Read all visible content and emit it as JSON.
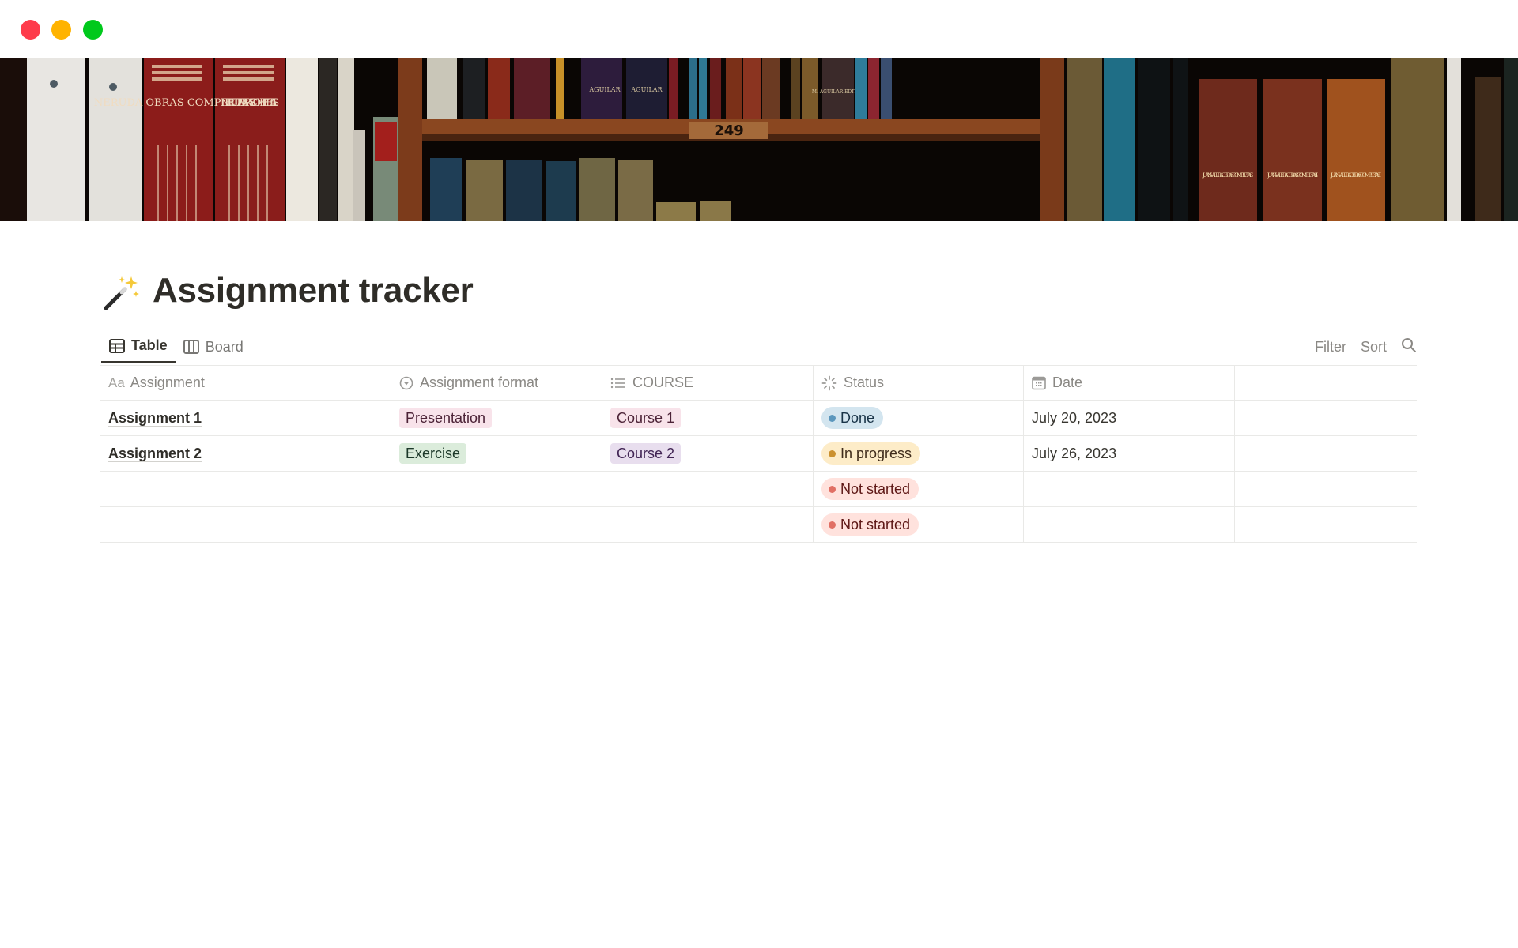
{
  "window": {
    "controls": [
      "close",
      "minimize",
      "zoom"
    ]
  },
  "banner": {
    "description": "Bookshelf photo cover",
    "shelf_label": "249",
    "spine_texts": [
      "NERUDA OBRAS COMPLETAS I",
      "NERUDA OBRAS COMPLETAS II",
      "AGUILAR",
      "AGUILAR",
      "M. AGUILAR EDITOR",
      "JUAN VALERA OBRAS COMPLETAS I",
      "JUAN VALERA OBRAS COMPLETAS II",
      "JUAN VALERA OBRAS COMPLETAS III"
    ]
  },
  "page": {
    "icon": "magic-wand-icon",
    "icon_glyph": "🪄",
    "title": "Assignment tracker"
  },
  "views": {
    "tabs": [
      {
        "label": "Table",
        "icon": "table-icon",
        "active": true
      },
      {
        "label": "Board",
        "icon": "board-icon",
        "active": false
      }
    ],
    "actions": {
      "filter_label": "Filter",
      "sort_label": "Sort",
      "search_icon": "search-icon"
    }
  },
  "table": {
    "columns": [
      {
        "label": "Assignment",
        "icon": "title-aa-icon",
        "icon_text": "Aa"
      },
      {
        "label": "Assignment format",
        "icon": "select-icon"
      },
      {
        "label": "COURSE",
        "icon": "multi-select-list-icon"
      },
      {
        "label": "Status",
        "icon": "status-icon"
      },
      {
        "label": "Date",
        "icon": "calendar-icon"
      },
      {
        "label": ""
      }
    ],
    "rows": [
      {
        "assignment": "Assignment 1",
        "format": "Presentation",
        "course": "Course 1",
        "status": "Done",
        "date": "July 20, 2023"
      },
      {
        "assignment": "Assignment 2",
        "format": "Exercise",
        "course": "Course 2",
        "status": "In progress",
        "date": "July 26, 2023"
      },
      {
        "assignment": "",
        "format": "",
        "course": "",
        "status": "Not started",
        "date": ""
      },
      {
        "assignment": "",
        "format": "",
        "course": "",
        "status": "Not started",
        "date": ""
      }
    ]
  },
  "colors": {
    "traffic_red": "#fe3b4b",
    "traffic_yellow": "#ffb300",
    "traffic_green": "#00c91c",
    "format_presentation_bg": "#f8e3ea",
    "format_exercise_bg": "#dbecdb",
    "course_1_bg": "#f8e3ea",
    "course_2_bg": "#e8deee",
    "status_done_bg": "#d3e5ef",
    "status_in_progress_bg": "#fdecc8",
    "status_not_started_bg": "#ffe2dd"
  }
}
